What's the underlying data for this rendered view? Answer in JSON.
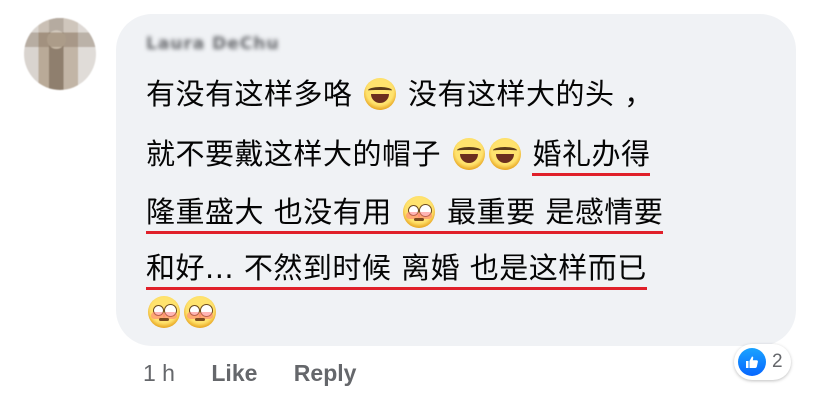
{
  "comment": {
    "author": "Laura DeChu",
    "lines": [
      [
        "有没有这样多咯",
        "没有这样大的头 ，"
      ],
      [
        "就不要戴这样大的帽子",
        "婚礼办得"
      ],
      [
        "隆重盛大 也没有用",
        "最重要 是感情要"
      ],
      [
        "和好... 不然到时候 离婚 也是这样而已"
      ]
    ],
    "emojis": {
      "laugh": "laughing-tears-emoji",
      "flushed": "flushed-emoji"
    }
  },
  "actions": {
    "time": "1 h",
    "like_label": "Like",
    "reply_label": "Reply"
  },
  "reactions": {
    "icon": "thumbs-up-icon",
    "count": "2",
    "color": "#0766ff"
  },
  "colors": {
    "bubble": "#f0f2f5",
    "underline": "#e0202a",
    "meta": "#65676b"
  }
}
